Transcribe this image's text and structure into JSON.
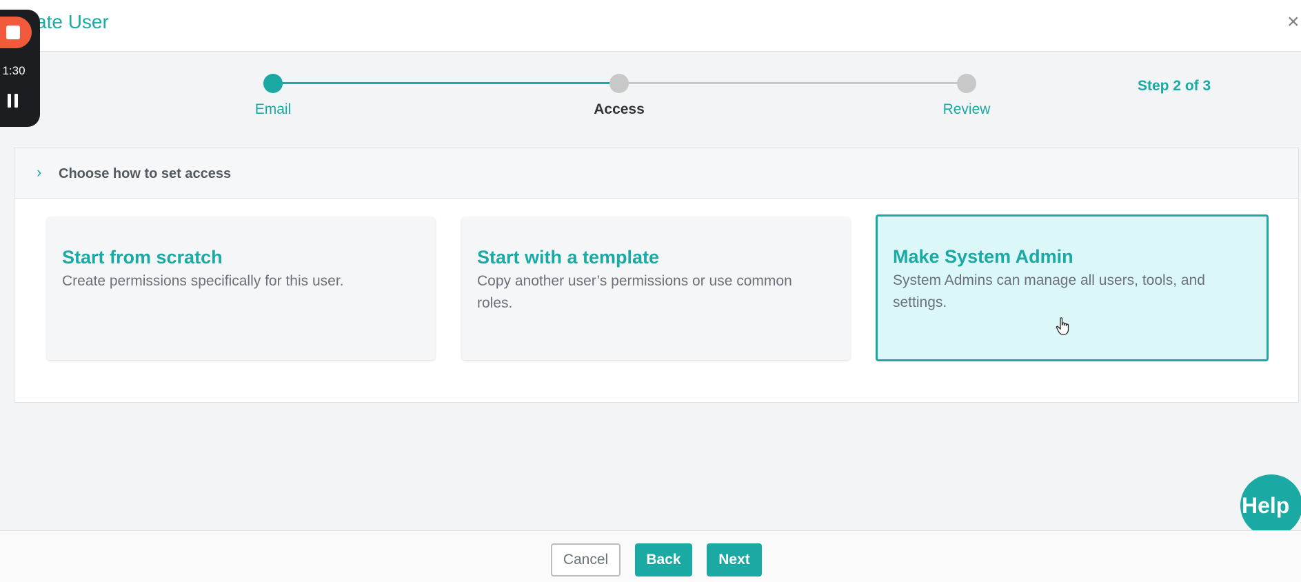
{
  "window": {
    "title": "ate User",
    "close_glyph": "×"
  },
  "recorder": {
    "time": "1:30",
    "stop_icon": "stop-icon",
    "pause_icon": "pause-icon"
  },
  "stepper": {
    "steps": [
      {
        "label": "Email",
        "state": "complete"
      },
      {
        "label": "Access",
        "state": "current"
      },
      {
        "label": "Review",
        "state": "upcoming"
      }
    ],
    "step_count": "Step 2 of 3"
  },
  "panel": {
    "chevron_icon": "chevron-right-icon",
    "chevron": "›",
    "title": "Choose how to set access"
  },
  "options": [
    {
      "title": "Start from scratch",
      "description": "Create permissions specifically for this user.",
      "selected": false
    },
    {
      "title": "Start with a template",
      "description": "Copy another user’s permissions or use common roles.",
      "selected": false
    },
    {
      "title": "Make System Admin",
      "description": "System Admins can manage all users, tools, and settings.",
      "selected": true
    }
  ],
  "help": {
    "label": "Help"
  },
  "footer": {
    "cancel_label": "Cancel",
    "back_label": "Back",
    "next_label": "Next"
  },
  "colors": {
    "accent": "#1aa9a3",
    "inactive": "#c8c8c8",
    "selected_bg": "#dcf7f8"
  }
}
